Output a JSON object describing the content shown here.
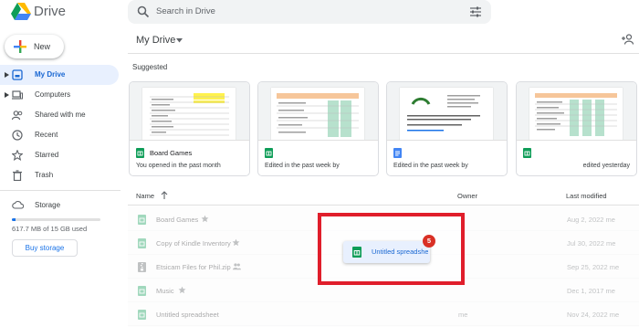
{
  "app": {
    "name": "Drive"
  },
  "search": {
    "placeholder": "Search in Drive"
  },
  "new_button": {
    "label": "New"
  },
  "sidebar": {
    "items": [
      {
        "label": "My Drive",
        "icon": "drive-icon",
        "active": true
      },
      {
        "label": "Computers",
        "icon": "computer-icon",
        "active": false
      },
      {
        "label": "Shared with me",
        "icon": "shared-icon",
        "active": false
      },
      {
        "label": "Recent",
        "icon": "clock-icon",
        "active": false
      },
      {
        "label": "Starred",
        "icon": "star-icon",
        "active": false
      },
      {
        "label": "Trash",
        "icon": "trash-icon",
        "active": false
      }
    ],
    "storage": {
      "label": "Storage",
      "used_text": "617.7 MB of 15 GB used",
      "used_fraction": 0.04,
      "buy_label": "Buy storage"
    }
  },
  "main": {
    "title": "My Drive",
    "suggested_label": "Suggested",
    "cards": [
      {
        "name": "Board Games",
        "type": "sheets",
        "subtitle": "You opened in the past month"
      },
      {
        "name": "",
        "type": "sheets",
        "subtitle": "Edited in the past week by"
      },
      {
        "name": "",
        "type": "docs",
        "subtitle": "Edited in the past week by"
      },
      {
        "name": "",
        "type": "sheets",
        "subtitle": "edited yesterday"
      }
    ],
    "list": {
      "columns": {
        "name": "Name",
        "owner": "Owner",
        "modified": "Last modified"
      },
      "rows": [
        {
          "name": "Board Games",
          "type": "sheets",
          "starred": true,
          "shared": false,
          "owner": "",
          "modified": "Aug 2, 2022 me"
        },
        {
          "name": "Copy of Kindle Inventory",
          "type": "sheets",
          "starred": true,
          "shared": false,
          "owner": "",
          "modified": "Jul 30, 2022 me"
        },
        {
          "name": "Etsicam Files for Phil.zip",
          "type": "zip",
          "starred": false,
          "shared": true,
          "owner": "",
          "modified": "Sep 25, 2022 me"
        },
        {
          "name": "Music",
          "type": "sheets",
          "starred": true,
          "shared": false,
          "owner": "",
          "modified": "Dec 1, 2017 me"
        },
        {
          "name": "Untitled spreadsheet",
          "type": "sheets",
          "starred": false,
          "shared": false,
          "owner": "me",
          "modified": "Nov 24, 2022 me"
        }
      ]
    }
  },
  "drag": {
    "label": "Untitled spreadsheet",
    "count": "5",
    "highlight_color": "#e01e2b"
  },
  "colors": {
    "accent": "#1a73e8",
    "active_bg": "#e8f0fe",
    "sheets_green": "#0f9d58",
    "docs_blue": "#4285f4"
  }
}
